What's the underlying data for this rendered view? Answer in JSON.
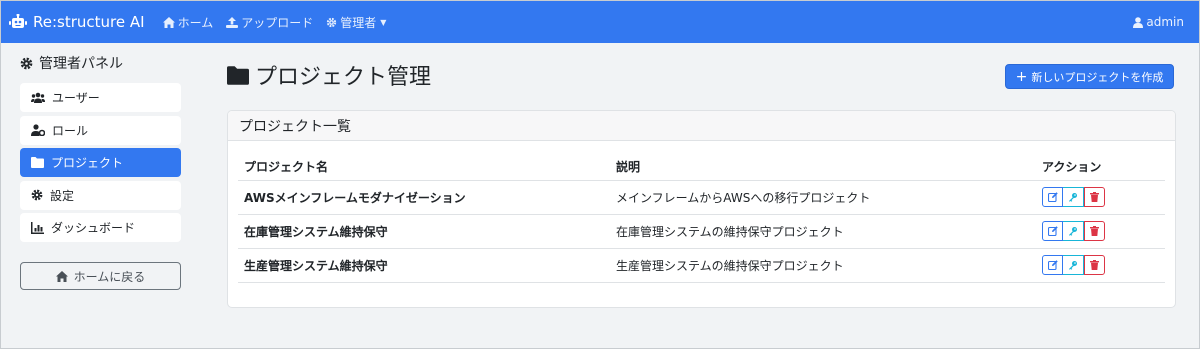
{
  "navbar": {
    "brand": "Re:structure AI",
    "links": [
      {
        "label": "ホーム",
        "icon": "home-icon"
      },
      {
        "label": "アップロード",
        "icon": "upload-icon"
      },
      {
        "label": "管理者",
        "icon": "gear-icon"
      }
    ],
    "user": "admin"
  },
  "sidebar": {
    "title": "管理者パネル",
    "items": [
      {
        "label": "ユーザー",
        "icon": "users-icon"
      },
      {
        "label": "ロール",
        "icon": "user-gear-icon"
      },
      {
        "label": "プロジェクト",
        "icon": "folder-icon",
        "active": true
      },
      {
        "label": "設定",
        "icon": "gear-icon"
      },
      {
        "label": "ダッシュボード",
        "icon": "chart-icon"
      }
    ],
    "home_button": "ホームに戻る"
  },
  "main": {
    "title": "プロジェクト管理",
    "new_button": "新しいプロジェクトを作成",
    "card_title": "プロジェクト一覧",
    "columns": [
      "プロジェクト名",
      "説明",
      "アクション"
    ],
    "rows": [
      {
        "name": "AWSメインフレームモダナイゼーション",
        "description": "メインフレームからAWSへの移行プロジェクト"
      },
      {
        "name": "在庫管理システム維持保守",
        "description": "在庫管理システムの維持保守プロジェクト"
      },
      {
        "name": "生産管理システム維持保守",
        "description": "生産管理システムの維持保守プロジェクト"
      }
    ]
  },
  "colors": {
    "primary": "#3378f0",
    "info": "#18b5d8",
    "danger": "#dc3545",
    "background": "#f1f3f5"
  }
}
